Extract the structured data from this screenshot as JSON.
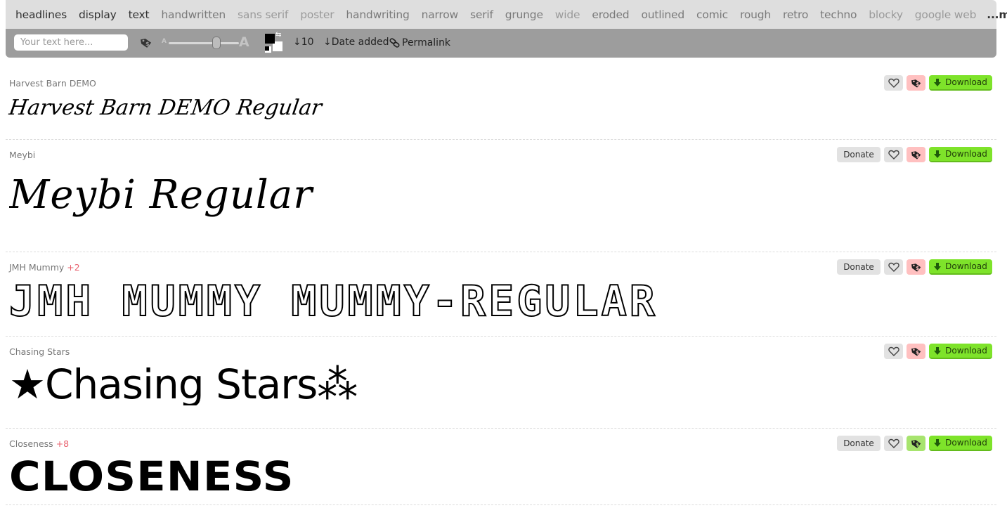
{
  "categories": [
    {
      "label": "headlines",
      "tone": "dark"
    },
    {
      "label": "display",
      "tone": "dark"
    },
    {
      "label": "text",
      "tone": "dark"
    },
    {
      "label": "handwritten",
      "tone": "mid"
    },
    {
      "label": "sans serif",
      "tone": "light"
    },
    {
      "label": "poster",
      "tone": "light"
    },
    {
      "label": "handwriting",
      "tone": "mid"
    },
    {
      "label": "narrow",
      "tone": "mid"
    },
    {
      "label": "serif",
      "tone": "mid"
    },
    {
      "label": "grunge",
      "tone": "mid"
    },
    {
      "label": "wide",
      "tone": "light"
    },
    {
      "label": "eroded",
      "tone": "mid"
    },
    {
      "label": "outlined",
      "tone": "mid"
    },
    {
      "label": "comic",
      "tone": "mid"
    },
    {
      "label": "rough",
      "tone": "mid"
    },
    {
      "label": "retro",
      "tone": "mid"
    },
    {
      "label": "techno",
      "tone": "mid"
    },
    {
      "label": "blocky",
      "tone": "light"
    },
    {
      "label": "google web",
      "tone": "light"
    },
    {
      "label": "...more",
      "tone": "more"
    }
  ],
  "toolbar": {
    "text_placeholder": "Your text here...",
    "text_value": "",
    "size_small_label": "A",
    "size_large_label": "A",
    "size_slider_value_pct": 68,
    "foreground_color": "#000000",
    "background_color": "#ffffff",
    "count_label": "↓10",
    "sort_label": "↓Date added",
    "permalink_label": "Permalink"
  },
  "fonts": [
    {
      "name": "Harvest Barn DEMO",
      "extra": "",
      "preview": "Harvest Barn DEMO Regular",
      "donate": false,
      "license": "pink",
      "donate_label": "Donate",
      "download_label": "Download"
    },
    {
      "name": "Meybi",
      "extra": "",
      "preview": "Meybi Regular",
      "donate": true,
      "license": "pink",
      "donate_label": "Donate",
      "download_label": "Download"
    },
    {
      "name": "JMH Mummy",
      "extra": "+2",
      "preview": "JMH MUMMY MUMMY-REGULAR",
      "donate": true,
      "license": "pink",
      "donate_label": "Donate",
      "download_label": "Download"
    },
    {
      "name": "Chasing Stars",
      "extra": "",
      "preview": "★Chasing Stars⁂",
      "donate": false,
      "license": "pink",
      "donate_label": "Donate",
      "download_label": "Download"
    },
    {
      "name": "Closeness",
      "extra": "+8",
      "preview": "CLOSENESS",
      "donate": true,
      "license": "green",
      "donate_label": "Donate",
      "download_label": "Download"
    }
  ],
  "colors": {
    "download": "#7ee32a",
    "license_pink": "#ffc0c0",
    "license_green": "#a7e46e",
    "extra_count": "#e8606d"
  }
}
